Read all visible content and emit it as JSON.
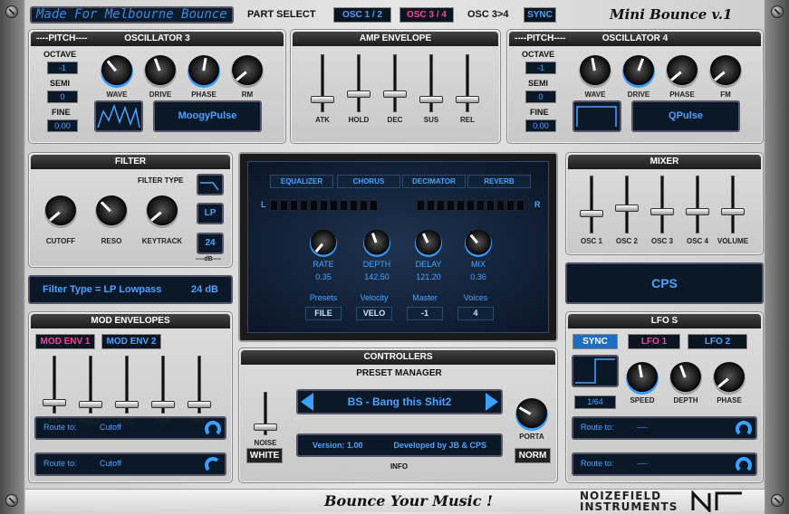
{
  "top": {
    "title": "Made For Melbourne Bounce",
    "part_select": "PART SELECT",
    "osc12": "OSC 1 / 2",
    "osc34": "OSC 3 / 4",
    "osc3to4": "OSC 3>4",
    "sync": "SYNC",
    "product": "Mini Bounce v.1"
  },
  "osc3": {
    "pitch": "----PITCH----",
    "title": "OSCILLATOR 3",
    "octave": "OCTAVE",
    "octave_val": "-1",
    "semi": "SEMI",
    "semi_val": "0",
    "fine": "FINE",
    "fine_val": "0.00",
    "knobs": [
      "WAVE",
      "DRIVE",
      "PHASE",
      "RM"
    ],
    "wave_name": "MoogyPulse"
  },
  "amp": {
    "title": "AMP ENVELOPE",
    "sliders": [
      "ATK",
      "HOLD",
      "DEC",
      "SUS",
      "REL"
    ]
  },
  "osc4": {
    "pitch": "----PITCH----",
    "title": "OSCILLATOR 4",
    "octave": "OCTAVE",
    "octave_val": "-1",
    "semi": "SEMI",
    "semi_val": "0",
    "fine": "FINE",
    "fine_val": "0.00",
    "knobs": [
      "WAVE",
      "DRIVE",
      "PHASE",
      "FM"
    ],
    "wave_name": "QPulse"
  },
  "filter": {
    "title": "FILTER",
    "filter_type": "FILTER TYPE",
    "type_btn": "LP",
    "db_val": "24",
    "db_label": "----dB----",
    "knobs": [
      "CUTOFF",
      "RESO",
      "KEYTRACK"
    ],
    "status": "Filter Type = LP Lowpass",
    "status_db": "24 dB"
  },
  "fx": {
    "tabs": [
      "EQUALIZER",
      "CHORUS",
      "DECIMATOR",
      "REVERB"
    ],
    "l": "L",
    "r": "R",
    "knobs": [
      {
        "label": "RATE",
        "value": "0.35"
      },
      {
        "label": "DEPTH",
        "value": "142.50"
      },
      {
        "label": "DELAY",
        "value": "121.20"
      },
      {
        "label": "MIX",
        "value": "0.36"
      }
    ],
    "bottom": [
      {
        "label": "Presets",
        "value": "FILE"
      },
      {
        "label": "Velocity",
        "value": "VELO"
      },
      {
        "label": "Master",
        "value": "-1"
      },
      {
        "label": "Voices",
        "value": "4"
      }
    ]
  },
  "mixer": {
    "title": "MIXER",
    "sliders": [
      "OSC 1",
      "OSC 2",
      "OSC 3",
      "OSC 4",
      "VOLUME"
    ],
    "cps": "CPS"
  },
  "modenv": {
    "title": "MOD ENVELOPES",
    "tab1": "MOD ENV 1",
    "tab2": "MOD ENV 2",
    "sliders": [
      "ATK",
      "HOLD",
      "DEC",
      "SUS",
      "REL"
    ],
    "route1_label": "Route to:",
    "route1_val": "Cutoff",
    "route2_label": "Route to:",
    "route2_val": "Cutoff"
  },
  "controllers": {
    "title": "CONTROLLERS",
    "preset_manager": "PRESET MANAGER",
    "preset": "BS - Bang this Shit2",
    "noise": "NOISE",
    "white": "WHITE",
    "porta": "PORTA",
    "norm": "NORM",
    "version": "Version: 1.00",
    "developed": "Developed by JB & CPS",
    "info": "INFO"
  },
  "lfo": {
    "title": "LFO S",
    "sync": "SYNC",
    "lfo1": "LFO 1",
    "lfo2": "LFO 2",
    "rate": "1/64",
    "knobs": [
      "SPEED",
      "DEPTH",
      "PHASE"
    ],
    "route1_label": "Route to:",
    "route1_val": "----",
    "route2_label": "Route to:",
    "route2_val": "----"
  },
  "bottom": {
    "tagline": "Bounce Your Music !",
    "brand1": "NOIZEFIELD",
    "brand2": "INSTRUMENTS"
  }
}
